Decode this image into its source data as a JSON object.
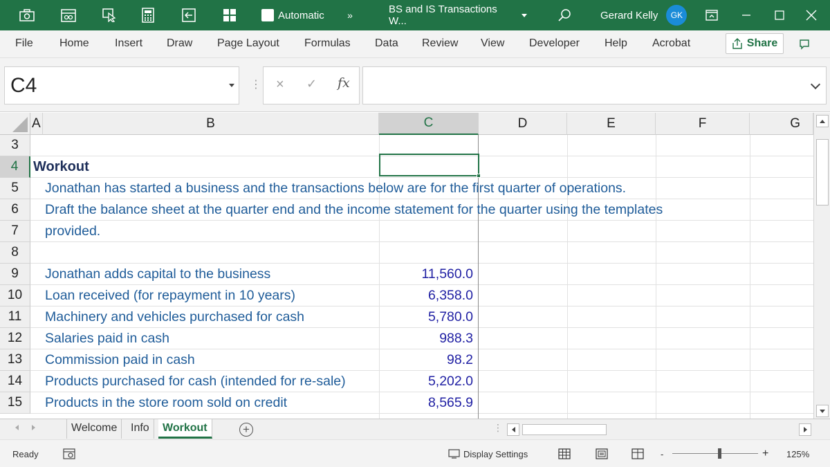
{
  "titlebar": {
    "autosave_label": "Automatic",
    "more_glyph": "»",
    "file_title": "BS and IS Transactions W...",
    "user_name": "Gerard Kelly",
    "user_initials": "GK",
    "icons": [
      "camera-icon",
      "calendar-icon",
      "pointer-icon",
      "calculator-icon",
      "back-icon",
      "grid-icon",
      "search-icon",
      "ribbon-display-icon",
      "minimize-icon",
      "maximize-icon",
      "close-icon"
    ],
    "bg_color": "#217346"
  },
  "ribbon": {
    "tabs": [
      "File",
      "Home",
      "Insert",
      "Draw",
      "Page Layout",
      "Formulas",
      "Data",
      "Review",
      "View",
      "Developer",
      "Help",
      "Acrobat"
    ],
    "share_label": "Share"
  },
  "formula_bar": {
    "name_box": "C4",
    "cancel_glyph": "×",
    "enter_glyph": "✓",
    "fx_label": "fx",
    "formula": ""
  },
  "grid": {
    "columns": [
      "A",
      "B",
      "C",
      "D",
      "E",
      "F",
      "G"
    ],
    "selected_column": "C",
    "rows": [
      "3",
      "4",
      "5",
      "6",
      "7",
      "8",
      "9",
      "10",
      "11",
      "12",
      "13",
      "14",
      "15"
    ],
    "selected_row": "4",
    "title": "Workout",
    "intro": [
      "Jonathan has started a business and the transactions below are for the first quarter of operations.",
      "Draft the balance sheet at the quarter end and the income statement for the quarter using the templates",
      "provided."
    ],
    "transactions": [
      {
        "label": "Jonathan adds capital to the business",
        "value": "11,560.0"
      },
      {
        "label": "Loan received (for repayment in 10 years)",
        "value": "6,358.0"
      },
      {
        "label": "Machinery and vehicles purchased for cash",
        "value": "5,780.0"
      },
      {
        "label": "Salaries paid in cash",
        "value": "988.3"
      },
      {
        "label": "Commission paid in cash",
        "value": "98.2"
      },
      {
        "label": "Products purchased for cash (intended for re-sale)",
        "value": "5,202.0"
      },
      {
        "label": "Products in the store room sold on credit",
        "value": "8,565.9"
      }
    ],
    "text_color": "#1f5c99",
    "number_color": "#1f1fa3"
  },
  "sheet_tabs": {
    "tabs": [
      "Welcome",
      "Info",
      "Workout"
    ],
    "active": "Workout",
    "add_glyph": "+"
  },
  "statusbar": {
    "mode": "Ready",
    "display_settings": "Display Settings",
    "zoom_minus": "-",
    "zoom_plus": "+",
    "zoom": "125%",
    "zoom_level_fraction": 0.55
  }
}
